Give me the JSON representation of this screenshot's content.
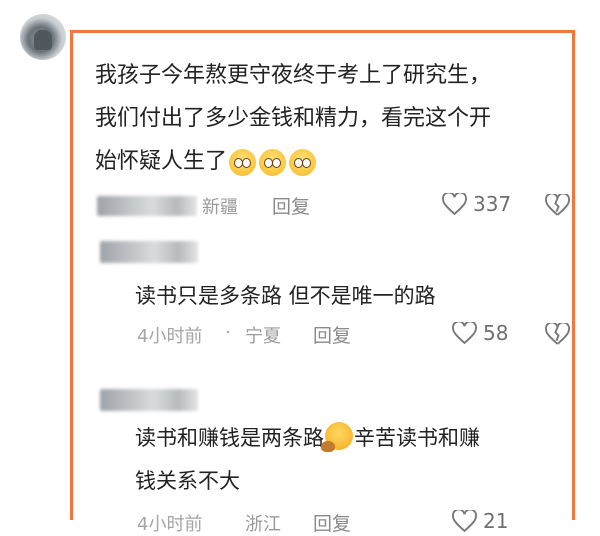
{
  "comment_main": {
    "lines": [
      "我孩子今年熬更守夜终于考上了研究生，",
      "我们付出了多少金钱和精力，看完这个开",
      "始怀疑人生了"
    ],
    "emoji": [
      "pleading-face",
      "pleading-face",
      "pleading-face"
    ],
    "location": "新疆",
    "reply_label": "回复",
    "likes": "337"
  },
  "replies": [
    {
      "text": "读书只是多条路 但不是唯一的路",
      "time": "4小时前",
      "separator": "·",
      "location": "宁夏",
      "reply_label": "回复",
      "likes": "58"
    },
    {
      "text_line1_a": "读书和赚钱是两条路",
      "emoji": "thinking-face",
      "text_line1_b": "辛苦读书和赚",
      "text_line2": "钱关系不大",
      "time": "4小时前",
      "location": "浙江",
      "reply_label": "回复",
      "likes": "21"
    }
  ],
  "colors": {
    "highlight_border": "#f2773f"
  }
}
